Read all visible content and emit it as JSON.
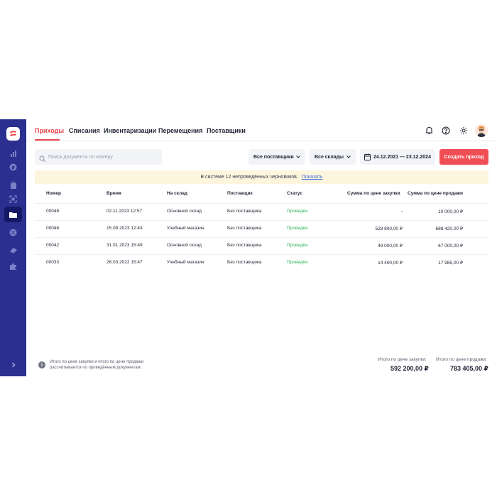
{
  "tabs": [
    {
      "label": "Приходы",
      "active": true
    },
    {
      "label": "Списания",
      "active": false
    },
    {
      "label": "Инвентаризации",
      "active": false
    },
    {
      "label": "Перемещения",
      "active": false
    },
    {
      "label": "Поставщики",
      "active": false
    }
  ],
  "header_icons": [
    "bell-icon",
    "help-icon",
    "gear-icon"
  ],
  "sidebar": {
    "icons": [
      "chart-icon",
      "ruble-icon",
      "bag-icon",
      "scan-icon",
      "folder-icon",
      "discount-icon",
      "ticket-icon",
      "puzzle-icon",
      "chevron-right-icon"
    ],
    "active": "folder-icon"
  },
  "search": {
    "placeholder": "Поиск документа по номеру",
    "value": ""
  },
  "filters": {
    "supplier": "Все поставщики",
    "warehouse": "Все склады",
    "date_range": "24.12.2021 — 23.12.2024"
  },
  "create_button": "Создать приход",
  "banner": {
    "text": "В системе 12 непроведённых черновиков.",
    "link": "Показать"
  },
  "table": {
    "columns": [
      "Номер",
      "Время",
      "На склад",
      "Поставщик",
      "Статус",
      "Сумма по цене закупки",
      "Сумма по цене продажи"
    ],
    "rows": [
      [
        "00048",
        "02.11.2023 12:57",
        "Основной склад",
        "Без поставщика",
        "Проведён",
        "-",
        "10 000,00 ₽"
      ],
      [
        "00046",
        "15.08.2023 12:43",
        "Учебный магазин",
        "Без поставщика",
        "Проведён",
        "528 800,00 ₽",
        "688 420,00 ₽"
      ],
      [
        "00042",
        "31.01.2023 15:49",
        "Основной склад",
        "Без поставщика",
        "Проведён",
        "49 000,00 ₽",
        "67 000,00 ₽"
      ],
      [
        "00033",
        "26.03.2022 15:47",
        "Учебный магазин",
        "Без поставщика",
        "Проведён",
        "14 400,00 ₽",
        "17 985,00 ₽"
      ]
    ]
  },
  "footer": {
    "note_line1": "Итого по цене закупки и итого по цене продажи",
    "note_line2": "рассчитывается по проведённым документам.",
    "purchase_label": "Итого по цене закупки:",
    "purchase_total": "592 200,00 ₽",
    "sale_label": "Итого по цене продажи:",
    "sale_total": "783 405,00 ₽"
  },
  "colors": {
    "sidebar": "#2b2f8f",
    "accent": "#f04e55",
    "status": "#2fb35a",
    "banner": "#fdf5dd"
  }
}
